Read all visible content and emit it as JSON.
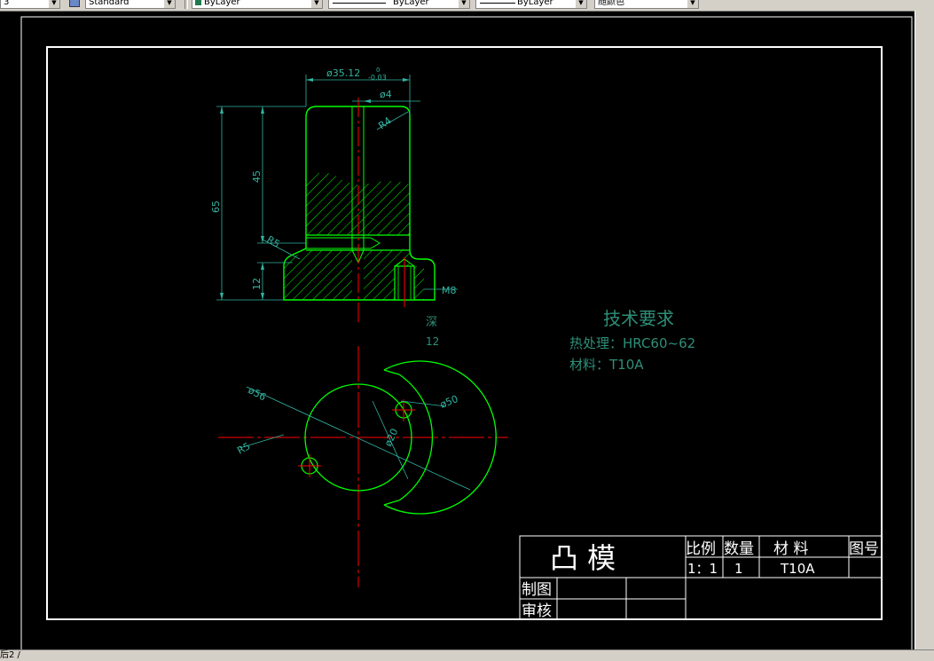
{
  "toolbar": {
    "combo1_value": "3",
    "text_style": "Standard",
    "layer_value": "ByLayer",
    "linetype_value": "ByLayer",
    "lineweight_value": "ByLayer",
    "plotstyle_value": "随颜色"
  },
  "status": {
    "command_text": "后2 /"
  },
  "colors": {
    "part": "#00ff00",
    "dimension": "#33b3a0",
    "centerline": "#ff0000",
    "hatch": "#00ff00",
    "frame": "#ffffff",
    "notes": "#2e8f78"
  },
  "drawing": {
    "dims": {
      "top_diameter": "ø35.12",
      "top_tol_upper": "0",
      "top_tol_lower": "-0.03",
      "hole_diameter": "ø4",
      "corner_radius": "R4",
      "height_45": "45",
      "height_65": "65",
      "fillet_r5": "R5",
      "height_12": "12",
      "thread": "M8",
      "depth_label": "深",
      "depth_value": "12",
      "plan_d56": "ø56",
      "plan_d50": "ø50",
      "plan_d20": "ø20",
      "plan_r5": "R5"
    },
    "notes": {
      "title": "技术要求",
      "heat_treatment": "热处理：HRC60~62",
      "material": "材料：T10A"
    },
    "title_block": {
      "part_name": "凸  模",
      "scale_header": "比例",
      "qty_header": "数量",
      "material_header": "材    料",
      "drawing_no_header": "图号",
      "scale_value": "1：1",
      "qty_value": "1",
      "material_value": "T10A",
      "drawn_by": "制图",
      "checked_by": "审核"
    }
  }
}
